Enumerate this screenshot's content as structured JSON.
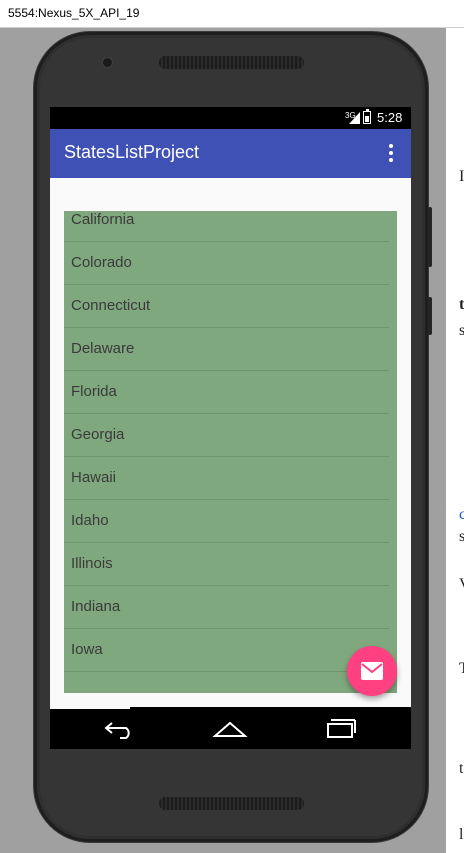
{
  "window": {
    "title": "5554:Nexus_5X_API_19"
  },
  "statusbar": {
    "network": "3G",
    "time": "5:28"
  },
  "appbar": {
    "title": "StatesListProject",
    "overflow_icon": "more-vert-icon"
  },
  "list": {
    "items": [
      "California",
      "Colorado",
      "Connecticut",
      "Delaware",
      "Florida",
      "Georgia",
      "Hawaii",
      "Idaho",
      "Illinois",
      "Indiana",
      "Iowa"
    ],
    "background_color": "#80a87e"
  },
  "fab": {
    "icon": "email-icon",
    "color": "#ff4081"
  },
  "navbar": {
    "back_icon": "back-icon",
    "home_icon": "home-icon",
    "recents_icon": "recents-icon"
  },
  "side_strip": {
    "chars": [
      "I",
      "t",
      "s",
      "c",
      "s",
      "V",
      "T",
      "t",
      "l"
    ]
  },
  "colors": {
    "primary": "#3f51b5",
    "accent": "#ff4081"
  }
}
